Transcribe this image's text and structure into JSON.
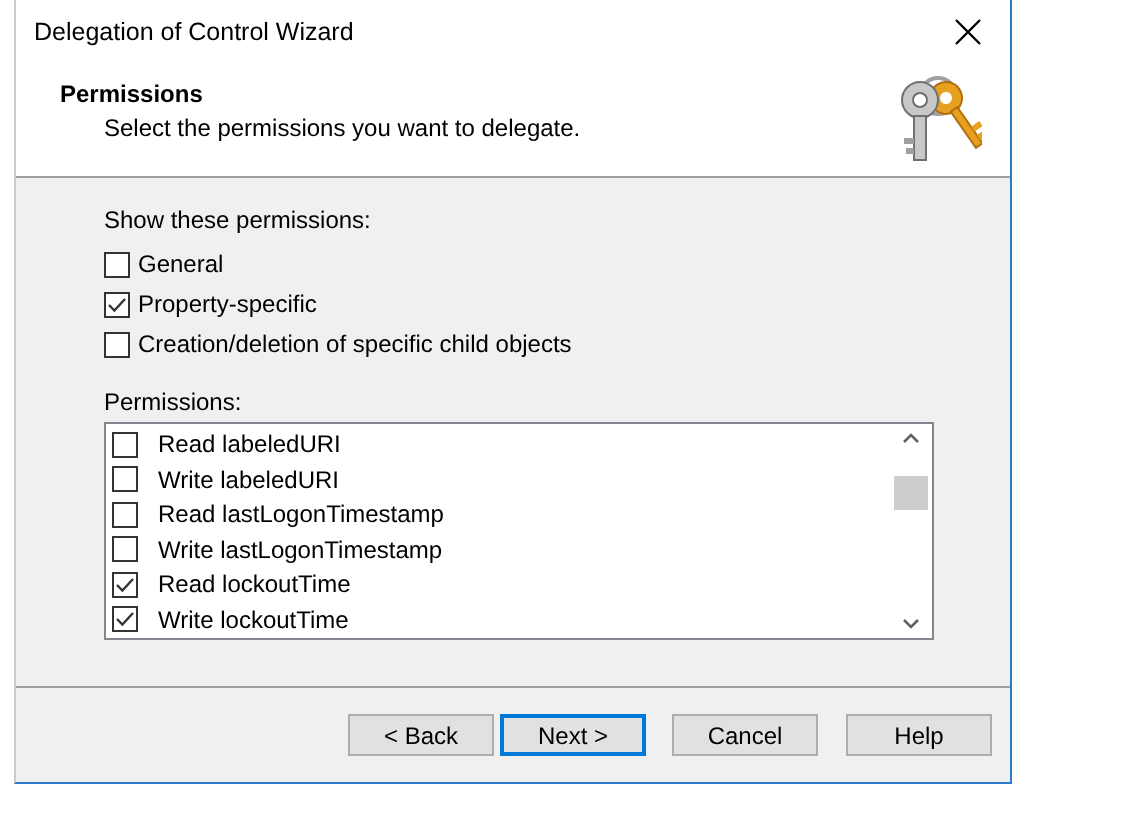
{
  "window": {
    "title": "Delegation of Control Wizard"
  },
  "header": {
    "title": "Permissions",
    "subtitle": "Select the permissions you want to delegate."
  },
  "filters": {
    "label": "Show these permissions:",
    "options": [
      {
        "label": "General",
        "checked": false
      },
      {
        "label": "Property-specific",
        "checked": true
      },
      {
        "label": "Creation/deletion of specific child objects",
        "checked": false
      }
    ]
  },
  "permissions": {
    "label": "Permissions:",
    "items": [
      {
        "label": "Read labeledURI",
        "checked": false
      },
      {
        "label": "Write labeledURI",
        "checked": false
      },
      {
        "label": "Read lastLogonTimestamp",
        "checked": false
      },
      {
        "label": "Write lastLogonTimestamp",
        "checked": false
      },
      {
        "label": "Read lockoutTime",
        "checked": true
      },
      {
        "label": "Write lockoutTime",
        "checked": true
      }
    ]
  },
  "buttons": [
    {
      "label": "< Back",
      "default": false
    },
    {
      "label": "Next >",
      "default": true
    },
    {
      "label": "Cancel",
      "default": false
    },
    {
      "label": "Help",
      "default": false
    }
  ]
}
